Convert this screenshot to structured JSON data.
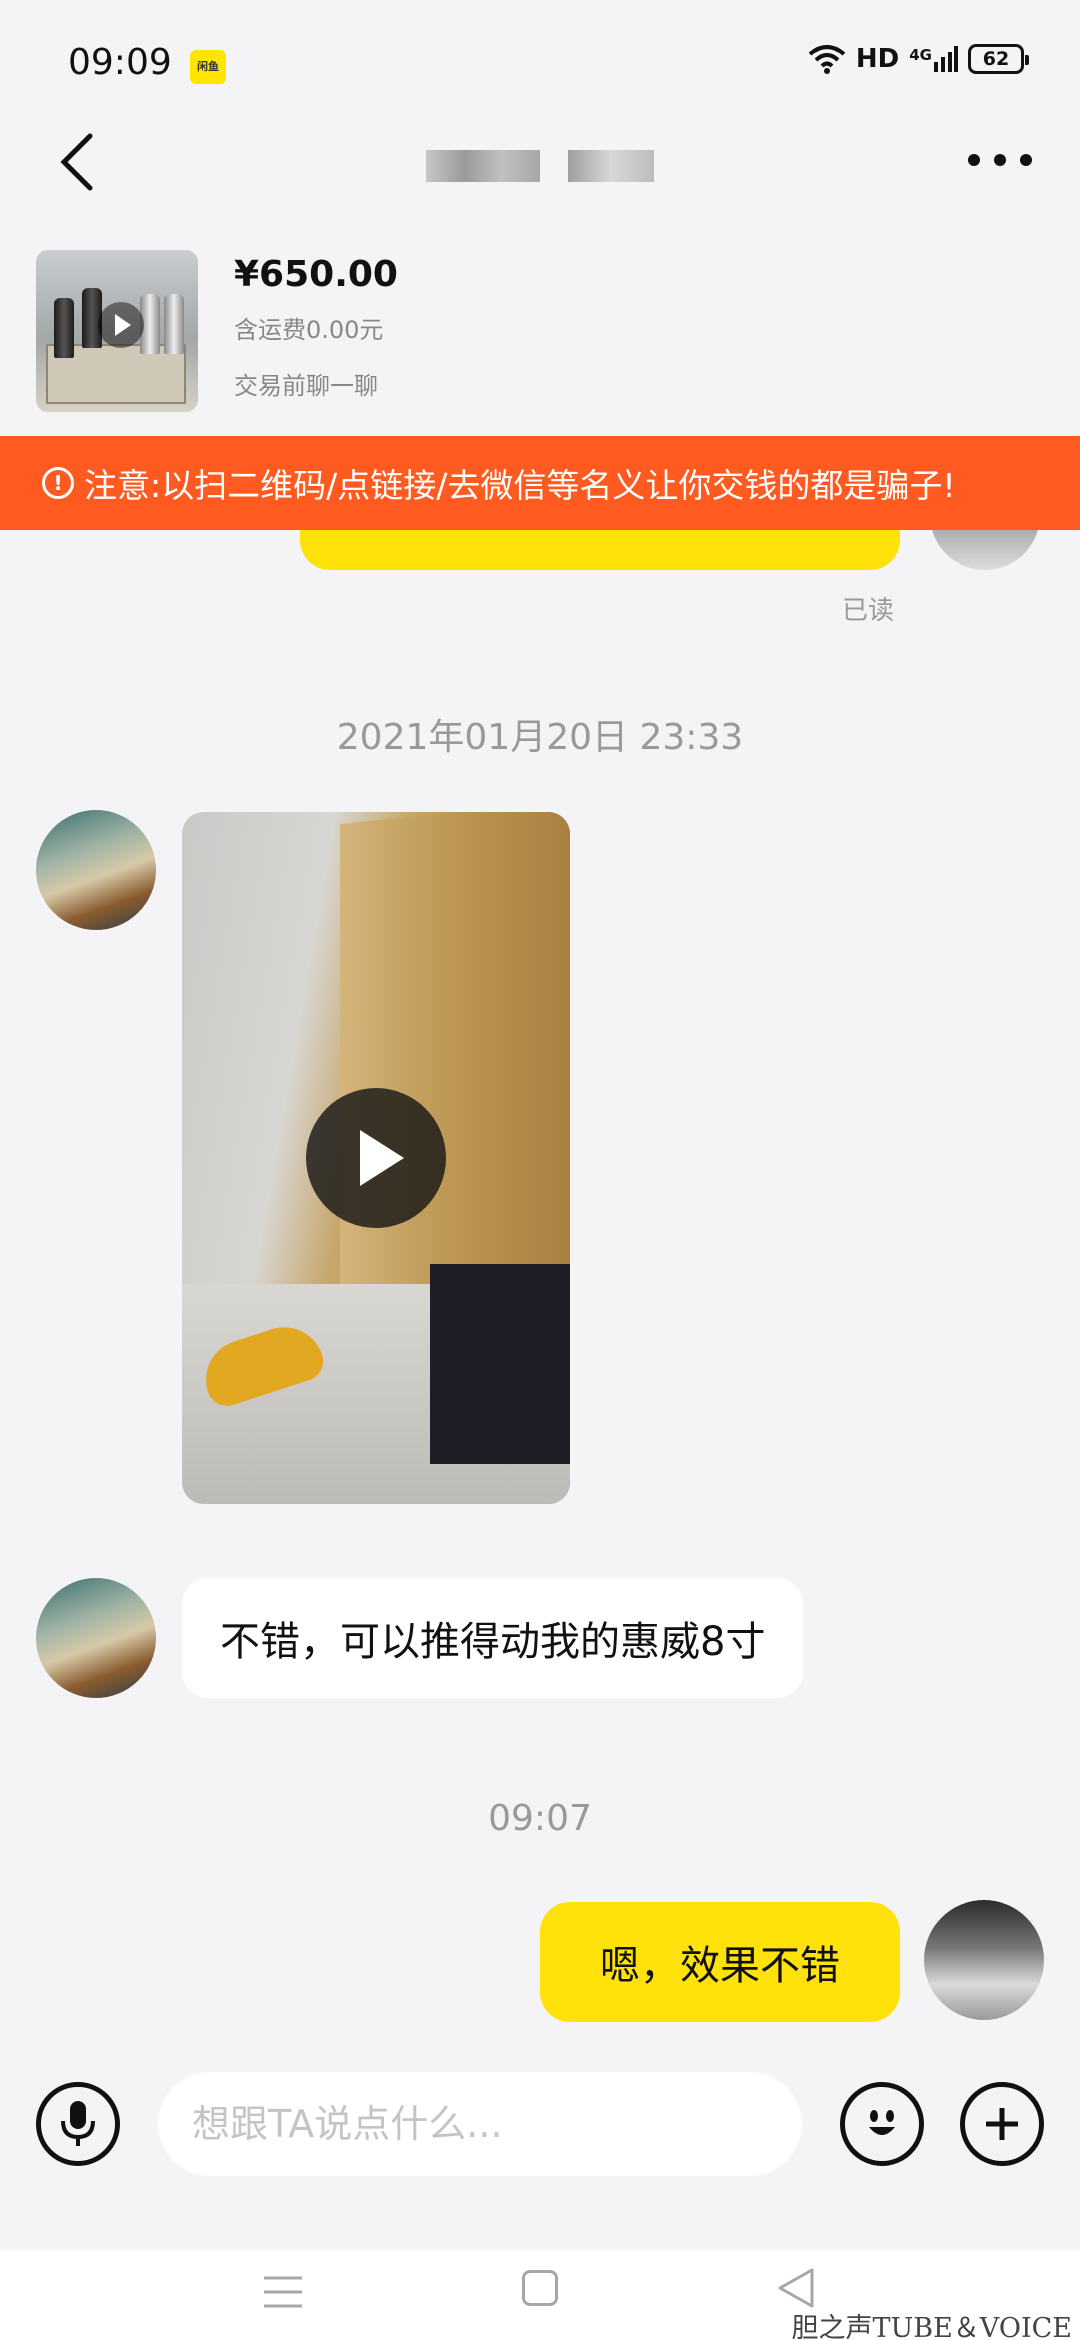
{
  "status_bar": {
    "time": "09:09",
    "app_badge": "闲鱼",
    "network_hd": "HD",
    "network_gen": "4G",
    "battery": "62"
  },
  "header": {
    "contact_name": "",
    "more_icon": "more-dots-icon"
  },
  "product": {
    "price": "¥650.00",
    "shipping": "含运费0.00元",
    "chat_hint": "交易前聊一聊"
  },
  "warning": {
    "text": "注意:以扫二维码/点链接/去微信等名义让你交钱的都是骗子!",
    "color": "#ff5a1f"
  },
  "messages": {
    "read_status": "已读",
    "timestamp_1": "2021年01月20日 23:33",
    "incoming_text": "不错，可以推得动我的惠威8寸",
    "timestamp_2": "09:07",
    "outgoing_text": "嗯，效果不错"
  },
  "input_bar": {
    "placeholder": "想跟TA说点什么..."
  },
  "colors": {
    "accent_yellow": "#ffe20a",
    "background": "#f4f4f6"
  },
  "watermark": "胆之声TUBE＆VOICE"
}
